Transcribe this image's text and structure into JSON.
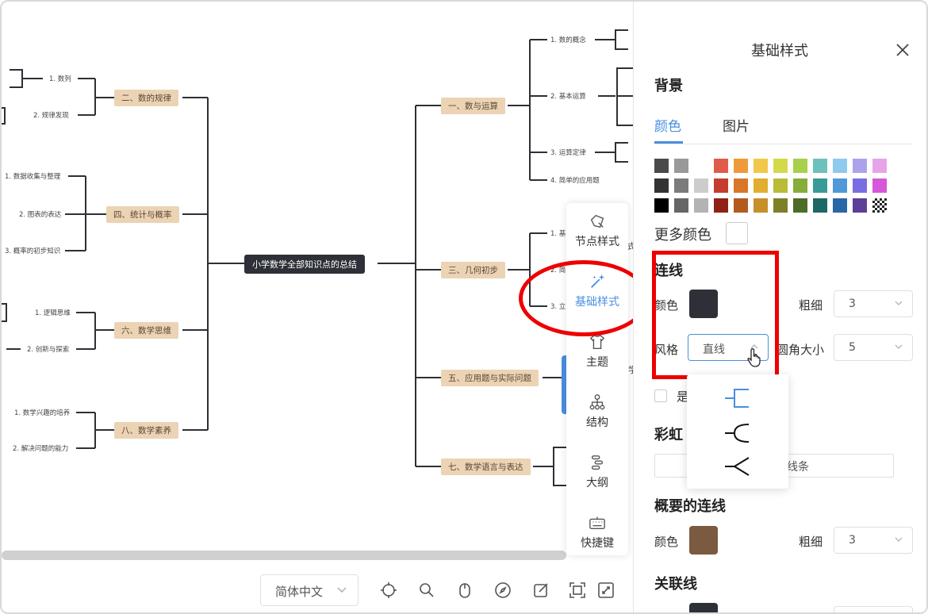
{
  "mindmap": {
    "root": "小学数学全部知识点的总结",
    "left_categories": [
      "二、数的规律",
      "四、统计与概率",
      "六、数学思维",
      "八、数学素养"
    ],
    "right_categories": [
      "一、数与运算",
      "三、几何初步",
      "五、应用题与实际问题",
      "七、数学语言与表达"
    ],
    "cat2_subs": [
      "1. 数列",
      "2. 规律发现"
    ],
    "cat4_subs": [
      "1. 数据收集与整理",
      "2. 图表的表达",
      "3. 概率的初步知识"
    ],
    "cat6_subs": [
      "1. 逻辑思维",
      "2. 创新与探索"
    ],
    "cat8_subs": [
      "1. 数学兴趣的培养",
      "2. 解决问题的能力"
    ],
    "cat1_subs": [
      "1. 数的概念",
      "2. 基本运算",
      "3. 运算定律",
      "4. 简单的应用题"
    ],
    "cat3_subs": [
      "1. 基本",
      "2. 简",
      "3. 立"
    ],
    "partial_texts": [
      "学",
      "式"
    ]
  },
  "toolbar": {
    "items": [
      {
        "label": "节点样式",
        "icon": "node-style-icon"
      },
      {
        "label": "基础样式",
        "icon": "magic-wand-icon"
      },
      {
        "label": "主题",
        "icon": "shirt-icon"
      },
      {
        "label": "结构",
        "icon": "structure-icon"
      },
      {
        "label": "大纲",
        "icon": "outline-icon"
      },
      {
        "label": "快捷键",
        "icon": "keyboard-icon"
      }
    ]
  },
  "panel": {
    "title": "基础样式",
    "background": {
      "heading": "背景",
      "tabs": [
        "颜色",
        "图片"
      ],
      "more_colors": "更多颜色"
    },
    "palette": [
      [
        "#4a4a4a",
        "#999999",
        "#ffffff",
        "#e05c4a",
        "#ee9a3a",
        "#f1c84a",
        "#d4d94a",
        "#a8d04a",
        "#6cc1bd",
        "#8ec9ee",
        "#aaa3ec",
        "#e7a3ea"
      ],
      [
        "#333333",
        "#7c7c7c",
        "#cccccc",
        "#c43d2f",
        "#d8772a",
        "#e2ae2f",
        "#b9bc37",
        "#86ad38",
        "#3a9a96",
        "#4f99d8",
        "#7b6ee0",
        "#d757d9"
      ],
      [
        "#000000",
        "#666666",
        "#b3b3b3",
        "#8f2217",
        "#b35a1e",
        "#c7902a",
        "#7e7f29",
        "#4e6b28",
        "#1c6866",
        "#2967a8",
        "#5d3f97",
        "transparent"
      ]
    ],
    "line": {
      "heading": "连线",
      "color_label": "颜色",
      "color": "#2d3036",
      "width_label": "粗细",
      "width": "3",
      "style_label": "风格",
      "style": "直线",
      "radius_label": "圆角大小",
      "radius": "5",
      "checkbox_partial": "是"
    },
    "rainbow": {
      "heading_partial": "彩虹",
      "input_partial": "线条"
    },
    "summary_line": {
      "heading": "概要的连线",
      "color_label": "颜色",
      "color": "#7a5a40",
      "width_label": "粗细",
      "width": "3"
    },
    "assoc_line": {
      "heading": "关联线"
    }
  },
  "bottom": {
    "language": "简体中文"
  }
}
